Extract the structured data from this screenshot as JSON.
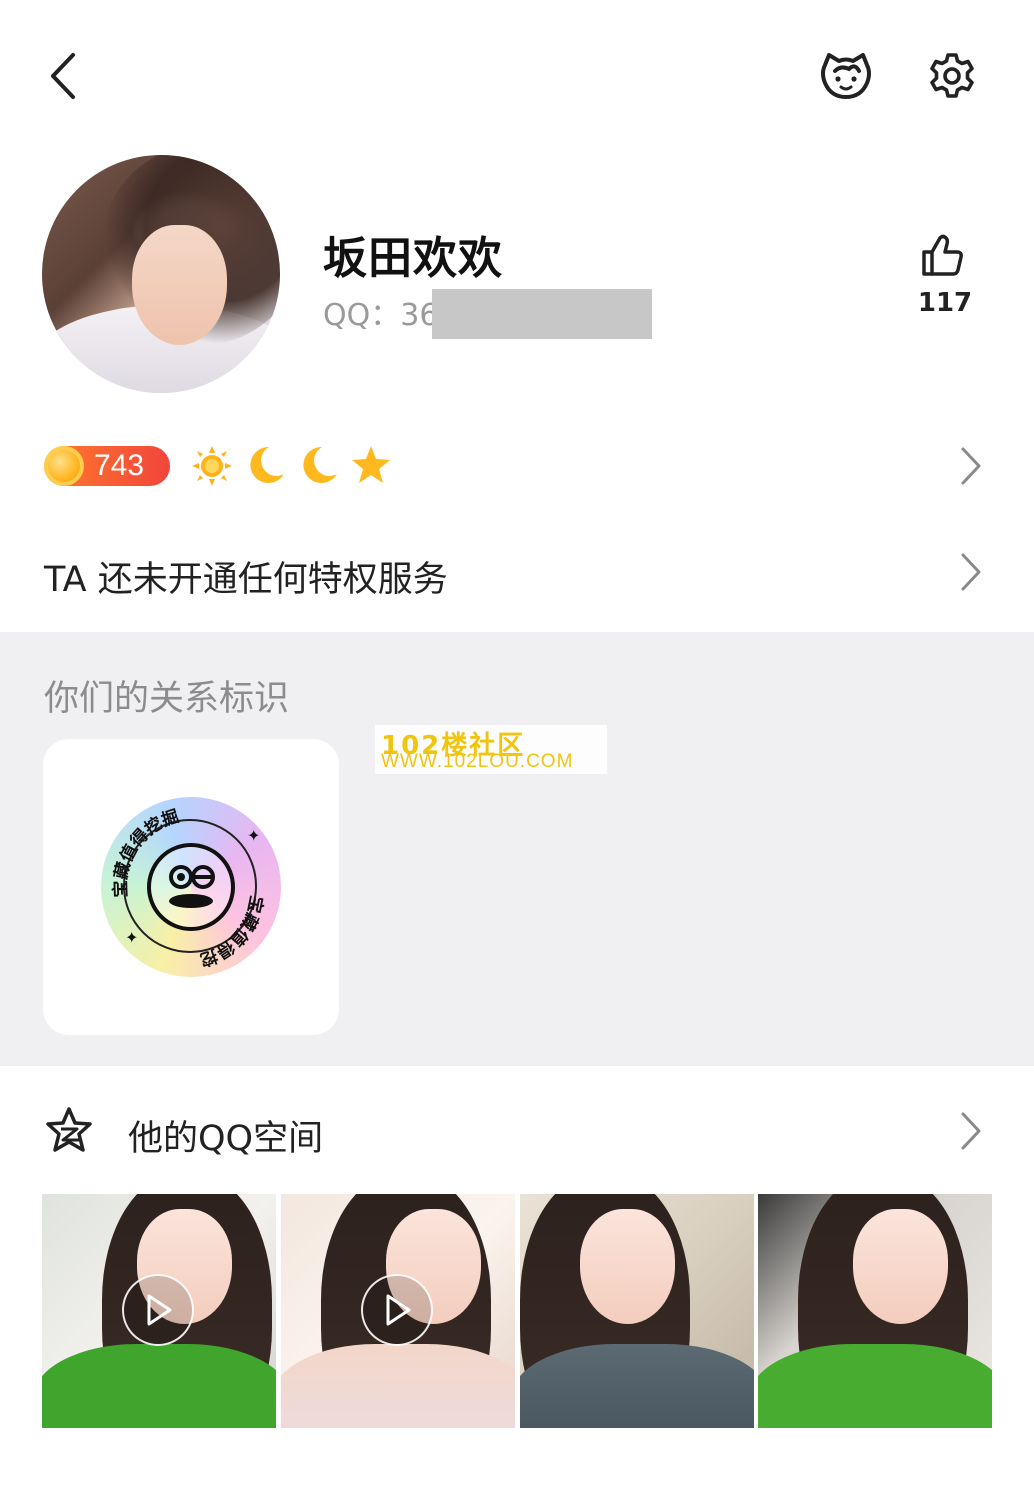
{
  "profile": {
    "nickname": "坂田欢欢",
    "qq_prefix": "QQ：36",
    "likes": "117"
  },
  "level": {
    "number": "743",
    "icons": [
      "sun-icon",
      "moon-icon",
      "moon-icon",
      "star-icon"
    ]
  },
  "privilege": {
    "text": "TA 还未开通任何特权服务"
  },
  "relation": {
    "title": "你们的关系标识",
    "badge_text": "宝藏值得挖掘"
  },
  "watermark": {
    "line1": "102楼社区",
    "line2": "WWW.102LOU.COM"
  },
  "qzone": {
    "title": "他的QQ空间",
    "photos": [
      {
        "type": "video"
      },
      {
        "type": "video"
      },
      {
        "type": "image"
      },
      {
        "type": "image"
      }
    ]
  },
  "colors": {
    "level_gradient_start": "#ff7a2b",
    "level_gradient_end": "#f2453c",
    "section_bg": "#f0f0f2",
    "watermark": "#f1c40f"
  }
}
